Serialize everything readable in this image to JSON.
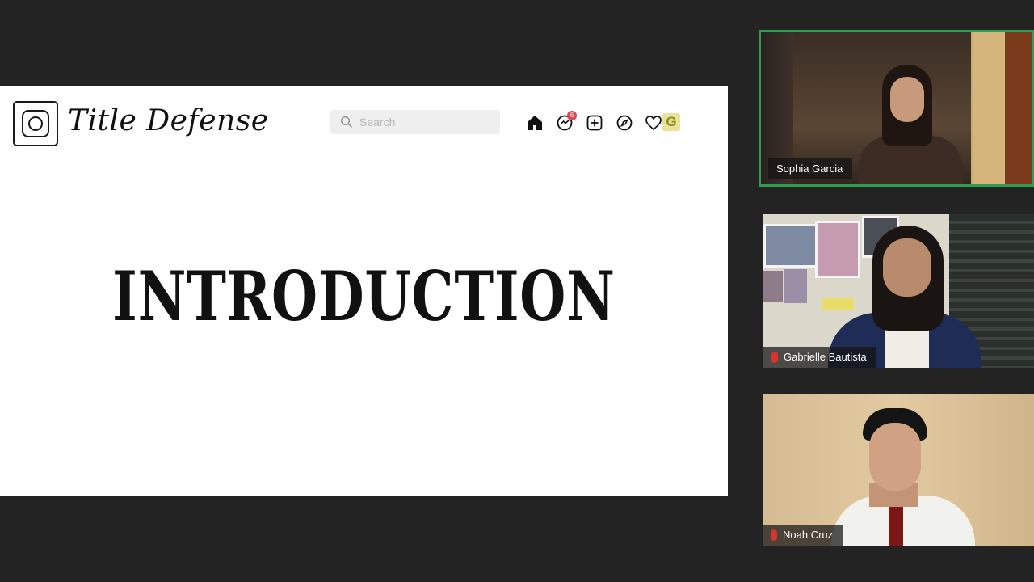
{
  "slide": {
    "brand": "Title Defense",
    "search_placeholder": "Search",
    "notification_count": "6",
    "avatar_letter": "G",
    "title": "INTRODUCTION"
  },
  "participants": [
    {
      "name": "Sophia Garcia",
      "muted": false,
      "active_speaker": true
    },
    {
      "name": "Gabrielle Bautista",
      "muted": true,
      "active_speaker": false
    },
    {
      "name": "Noah Cruz",
      "muted": true,
      "active_speaker": false
    }
  ],
  "icons": [
    "camera-logo-icon",
    "search-icon",
    "home-icon",
    "messenger-icon",
    "new-post-icon",
    "explore-icon",
    "heart-icon",
    "mic-muted-icon"
  ],
  "colors": {
    "active_border": "#2e9d4f",
    "mute_red": "#d9342b",
    "background": "#232323"
  }
}
